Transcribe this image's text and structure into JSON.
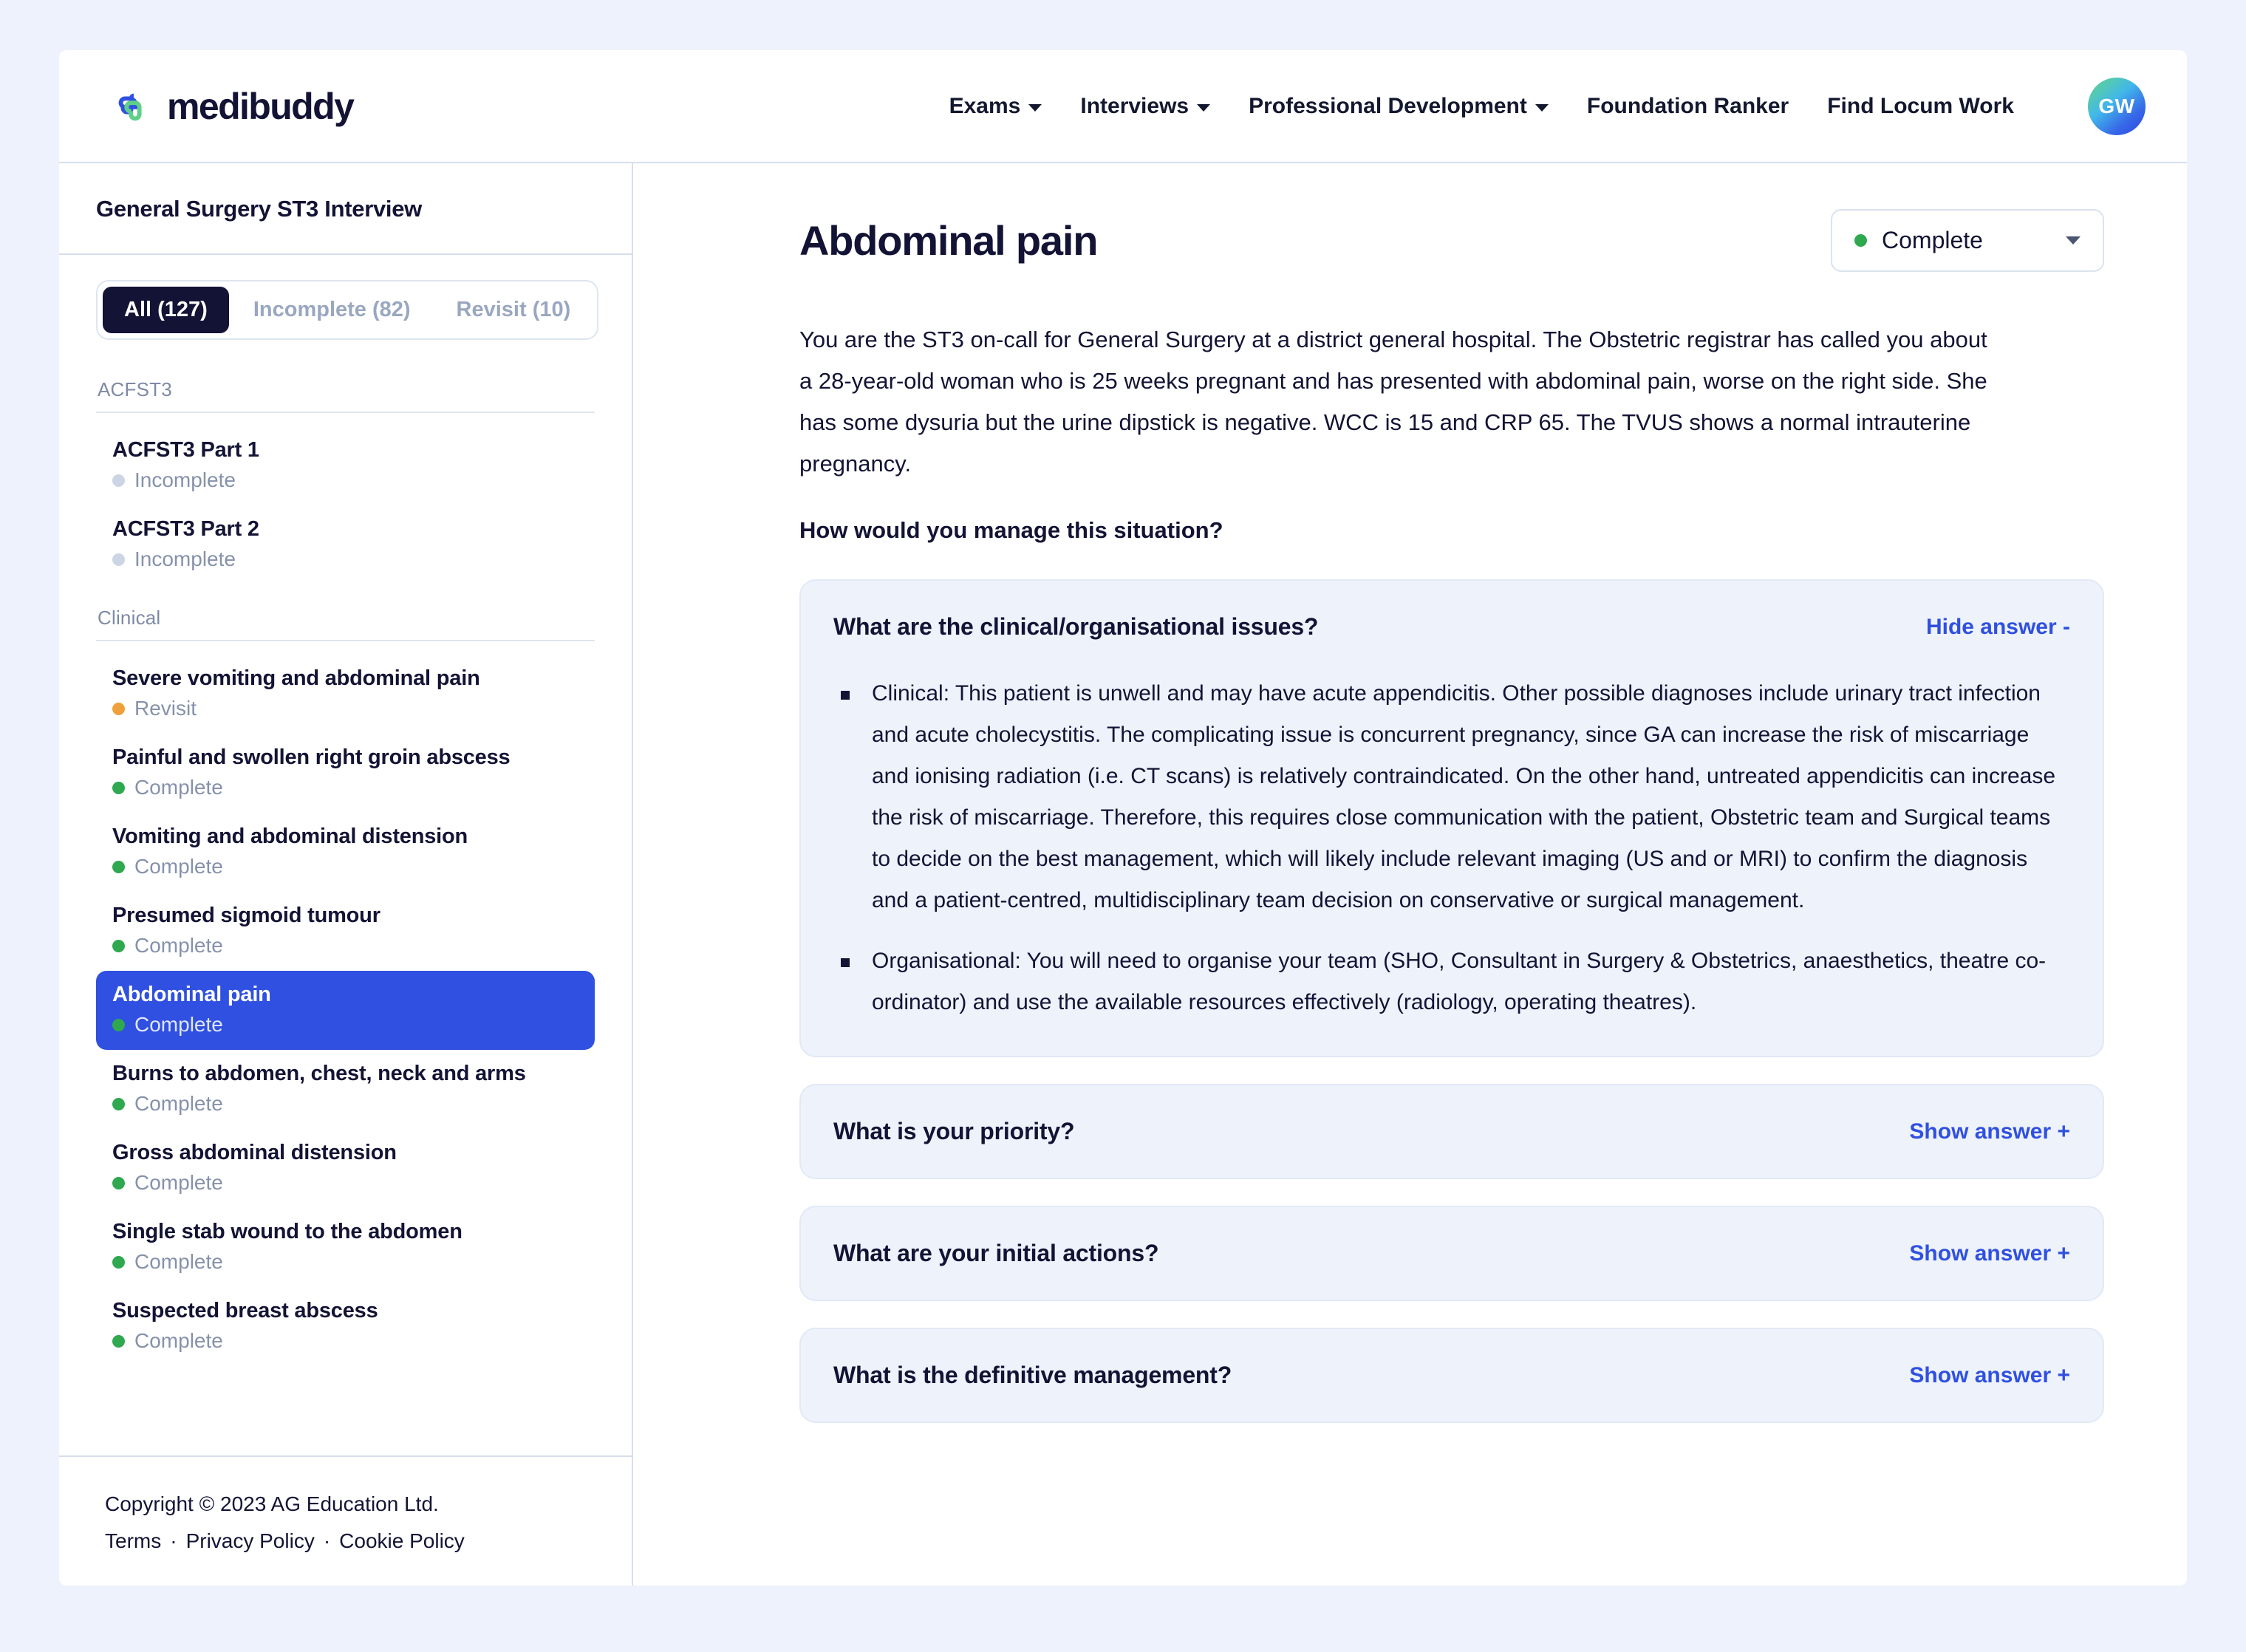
{
  "header": {
    "brand": "medibuddy",
    "nav": [
      {
        "label": "Exams",
        "has_caret": true
      },
      {
        "label": "Interviews",
        "has_caret": true
      },
      {
        "label": "Professional Development",
        "has_caret": true
      },
      {
        "label": "Foundation Ranker",
        "has_caret": false
      },
      {
        "label": "Find Locum Work",
        "has_caret": false
      }
    ],
    "avatar_initials": "GW"
  },
  "sidebar": {
    "title": "General Surgery ST3 Interview",
    "filters": [
      {
        "label": "All (127)",
        "active": true
      },
      {
        "label": "Incomplete (82)",
        "active": false
      },
      {
        "label": "Revisit (10)",
        "active": false
      }
    ],
    "groups": [
      {
        "label": "ACFST3",
        "items": [
          {
            "name": "ACFST3 Part 1",
            "status": "Incomplete",
            "status_kind": "incomplete",
            "selected": false
          },
          {
            "name": "ACFST3 Part 2",
            "status": "Incomplete",
            "status_kind": "incomplete",
            "selected": false
          }
        ]
      },
      {
        "label": "Clinical",
        "items": [
          {
            "name": "Severe vomiting and abdominal pain",
            "status": "Revisit",
            "status_kind": "revisit",
            "selected": false
          },
          {
            "name": "Painful and swollen right groin abscess",
            "status": "Complete",
            "status_kind": "complete",
            "selected": false
          },
          {
            "name": "Vomiting and abdominal distension",
            "status": "Complete",
            "status_kind": "complete",
            "selected": false
          },
          {
            "name": "Presumed sigmoid tumour",
            "status": "Complete",
            "status_kind": "complete",
            "selected": false
          },
          {
            "name": "Abdominal pain",
            "status": "Complete",
            "status_kind": "complete",
            "selected": true
          },
          {
            "name": "Burns to abdomen, chest, neck and arms",
            "status": "Complete",
            "status_kind": "complete",
            "selected": false
          },
          {
            "name": "Gross abdominal distension",
            "status": "Complete",
            "status_kind": "complete",
            "selected": false
          },
          {
            "name": "Single stab wound to the abdomen",
            "status": "Complete",
            "status_kind": "complete",
            "selected": false
          },
          {
            "name": "Suspected breast abscess",
            "status": "Complete",
            "status_kind": "complete",
            "selected": false
          }
        ]
      }
    ],
    "footer": {
      "copyright": "Copyright © 2023 AG Education Ltd.",
      "links": [
        "Terms",
        "Privacy Policy",
        "Cookie Policy"
      ],
      "separator": "·"
    }
  },
  "main": {
    "title": "Abdominal pain",
    "status": {
      "value": "Complete",
      "kind": "complete"
    },
    "scenario": "You are the ST3 on-call for General Surgery at a district general hospital. The Obstetric registrar has called you about a 28-year-old woman who is 25 weeks pregnant and has presented with abdominal pain, worse on the right side. She has some dysuria but the urine dipstick is negative. WCC is 15 and CRP 65. The TVUS shows a normal intrauterine pregnancy.",
    "prompt": "How would you manage this situation?",
    "questions": [
      {
        "title": "What are the clinical/organisational issues?",
        "toggle_label": "Hide answer -",
        "expanded": true,
        "bullets": [
          "Clinical: This patient is unwell and may have acute appendicitis. Other possible diagnoses include urinary tract infection and acute cholecystitis. The complicating issue is concurrent pregnancy, since GA can increase the risk of miscarriage and ionising radiation (i.e. CT scans) is relatively contraindicated. On the other hand, untreated appendicitis can increase the risk of miscarriage. Therefore, this requires close communication with the patient, Obstetric team and Surgical teams to decide on the best management, which will likely include relevant imaging (US and or MRI) to confirm the diagnosis and a patient-centred, multidisciplinary team decision on conservative or surgical management.",
          "Organisational: You will need to organise your team (SHO, Consultant in Surgery & Obstetrics, anaesthetics, theatre co-ordinator) and use the available resources effectively (radiology, operating theatres)."
        ]
      },
      {
        "title": "What is your priority?",
        "toggle_label": "Show answer +",
        "expanded": false,
        "bullets": []
      },
      {
        "title": "What are your initial actions?",
        "toggle_label": "Show answer +",
        "expanded": false,
        "bullets": []
      },
      {
        "title": "What is the definitive management?",
        "toggle_label": "Show answer +",
        "expanded": false,
        "bullets": []
      }
    ]
  },
  "colors": {
    "accent_blue": "#2f50e0",
    "status_complete": "#2fa84f",
    "status_revisit": "#f0a03a",
    "status_incomplete": "#ccd5e4",
    "page_bg": "#eef2fc",
    "card_bg": "#eef2fb"
  }
}
